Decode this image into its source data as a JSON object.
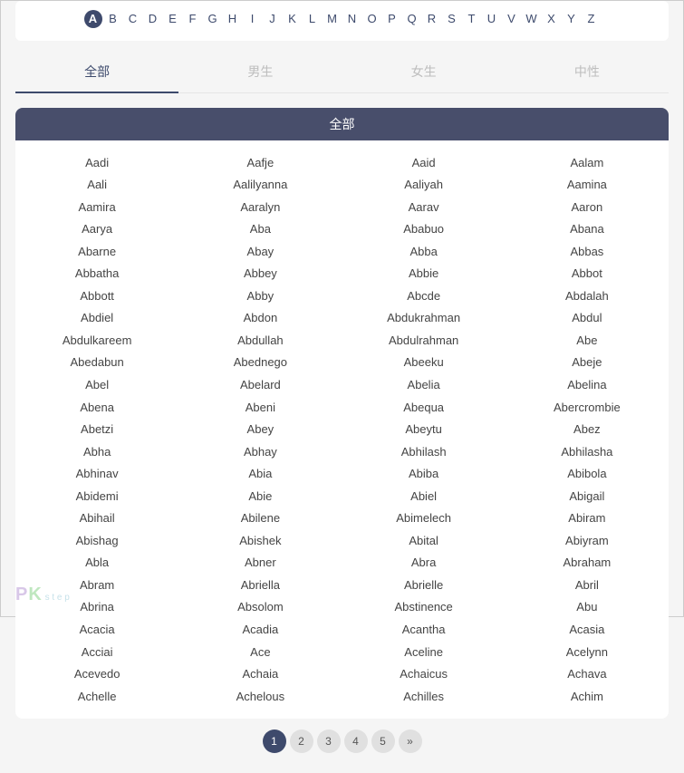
{
  "alphabet": {
    "letters": [
      "A",
      "B",
      "C",
      "D",
      "E",
      "F",
      "G",
      "H",
      "I",
      "J",
      "K",
      "L",
      "M",
      "N",
      "O",
      "P",
      "Q",
      "R",
      "S",
      "T",
      "U",
      "V",
      "W",
      "X",
      "Y",
      "Z"
    ],
    "active": "A"
  },
  "tabs": [
    {
      "id": "all",
      "label": "全部",
      "active": true
    },
    {
      "id": "male",
      "label": "男生",
      "active": false
    },
    {
      "id": "female",
      "label": "女生",
      "active": false
    },
    {
      "id": "neutral",
      "label": "中性",
      "active": false
    }
  ],
  "section_title": "全部",
  "names": [
    [
      "Aadi",
      "Aafje",
      "Aaid",
      "Aalam"
    ],
    [
      "Aali",
      "Aalilyanna",
      "Aaliyah",
      "Aamina"
    ],
    [
      "Aamira",
      "Aaralyn",
      "Aarav",
      "Aaron"
    ],
    [
      "Aarya",
      "Aba",
      "Ababuo",
      "Abana"
    ],
    [
      "Abarne",
      "Abay",
      "Abba",
      "Abbas"
    ],
    [
      "Abbatha",
      "Abbey",
      "Abbie",
      "Abbot"
    ],
    [
      "Abbott",
      "Abby",
      "Abcde",
      "Abdalah"
    ],
    [
      "Abdiel",
      "Abdon",
      "Abdukrahman",
      "Abdul"
    ],
    [
      "Abdulkareem",
      "Abdullah",
      "Abdulrahman",
      "Abe"
    ],
    [
      "Abedabun",
      "Abednego",
      "Abeeku",
      "Abeje"
    ],
    [
      "Abel",
      "Abelard",
      "Abelia",
      "Abelina"
    ],
    [
      "Abena",
      "Abeni",
      "Abequa",
      "Abercrombie"
    ],
    [
      "Abetzi",
      "Abey",
      "Abeytu",
      "Abez"
    ],
    [
      "Abha",
      "Abhay",
      "Abhilash",
      "Abhilasha"
    ],
    [
      "Abhinav",
      "Abia",
      "Abiba",
      "Abibola"
    ],
    [
      "Abidemi",
      "Abie",
      "Abiel",
      "Abigail"
    ],
    [
      "Abihail",
      "Abilene",
      "Abimelech",
      "Abiram"
    ],
    [
      "Abishag",
      "Abishek",
      "Abital",
      "Abiyram"
    ],
    [
      "Abla",
      "Abner",
      "Abra",
      "Abraham"
    ],
    [
      "Abram",
      "Abriella",
      "Abrielle",
      "Abril"
    ],
    [
      "Abrina",
      "Absolom",
      "Abstinence",
      "Abu"
    ],
    [
      "Acacia",
      "Acadia",
      "Acantha",
      "Acasia"
    ],
    [
      "Acciai",
      "Ace",
      "Aceline",
      "Acelynn"
    ],
    [
      "Acevedo",
      "Achaia",
      "Achaicus",
      "Achava"
    ],
    [
      "Achelle",
      "Achelous",
      "Achilles",
      "Achim"
    ]
  ],
  "pagination": {
    "pages": [
      "1",
      "2",
      "3",
      "4",
      "5"
    ],
    "next_label": "»",
    "active": "1"
  },
  "watermark": {
    "p": "P",
    "k": "K",
    "suffix": " s t e p"
  }
}
